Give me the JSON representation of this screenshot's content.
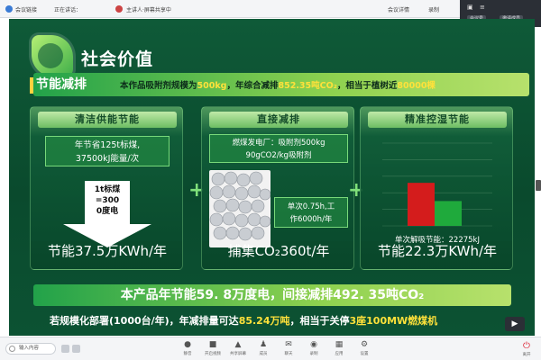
{
  "topbar": {
    "left_items": [
      "会议链接",
      "正在讲话：",
      "主讲人·屏幕共享中"
    ],
    "right_items": [
      "会议详情",
      "录制"
    ],
    "panel_pills": [
      "会议号",
      "邀请成员"
    ]
  },
  "slide": {
    "title": "社会价值",
    "headline_tag": "节能减排",
    "headline_parts": [
      {
        "text": "本作品吸附剂规模为",
        "hl": false
      },
      {
        "text": "500kg",
        "hl": true
      },
      {
        "text": "，年综合减排",
        "hl": false
      },
      {
        "text": "852.35吨CO₂",
        "hl": true
      },
      {
        "text": "，相当于植树近",
        "hl": false
      },
      {
        "text": "80000棵",
        "hl": true
      }
    ],
    "cards": [
      {
        "title": "清洁供能节能",
        "box_lines": [
          "年节省125t标煤,",
          "37500kJ能量/次"
        ],
        "arrow_lines": [
          "1t标煤",
          "=300",
          "0度电"
        ],
        "big": "节能37.5万KWh/年"
      },
      {
        "title": "直接减排",
        "box_lines": [
          "燃煤发电厂：吸附剂500kg",
          "90gCO2/kg吸附剂"
        ],
        "note_lines": [
          "单次0.75h,工",
          "作6000h/年"
        ],
        "big": "捕集CO₂360t/年"
      },
      {
        "title": "精准控湿节能",
        "label": "单次解吸节能：22275kJ",
        "big": "节能22.3万KWh/年"
      }
    ],
    "bottom_line1": "本产品年节能59. 8万度电，间接减排492. 35吨CO₂",
    "bottom_line2_parts": [
      {
        "text": "若规模化部署(1000台/年)，年减排量可达",
        "hl": false
      },
      {
        "text": "85.24万吨",
        "hl": true
      },
      {
        "text": "，相当于关停",
        "hl": false
      },
      {
        "text": "3座100MW燃煤机",
        "hl": true
      }
    ]
  },
  "chart_data": {
    "type": "bar",
    "categories": [
      "",
      ""
    ],
    "values": [
      52,
      30
    ],
    "colors": [
      "#d41c1c",
      "#1faa3c"
    ],
    "ylim": [
      0,
      100
    ],
    "grid": true
  },
  "bottombar": {
    "search_placeholder": "输入内容",
    "tools": [
      {
        "icon": "mic-icon",
        "glyph": "●",
        "label": "静音"
      },
      {
        "icon": "camera-icon",
        "glyph": "■",
        "label": "开启视频"
      },
      {
        "icon": "share-icon",
        "glyph": "▲",
        "label": "共享屏幕"
      },
      {
        "icon": "members-icon",
        "glyph": "♟",
        "label": "成员"
      },
      {
        "icon": "chat-icon",
        "glyph": "✉",
        "label": "聊天"
      },
      {
        "icon": "record-icon",
        "glyph": "◉",
        "label": "录制"
      },
      {
        "icon": "app-icon",
        "glyph": "▦",
        "label": "应用"
      },
      {
        "icon": "settings-icon",
        "glyph": "⚙",
        "label": "设置"
      }
    ],
    "leave_label": "离开"
  },
  "colors": {
    "slide_bg": "#0f5a38",
    "accent_green": "#8ed14f",
    "highlight_yellow": "#ffe13a"
  }
}
